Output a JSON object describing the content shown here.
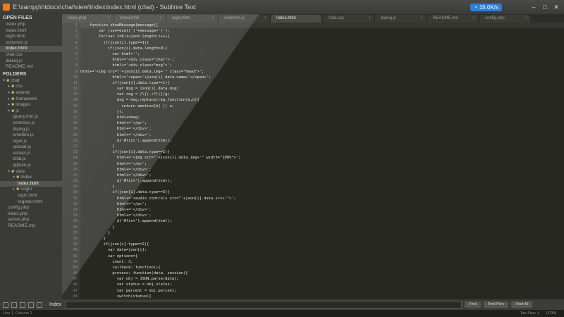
{
  "window": {
    "title": "E:\\xampp\\htdocs\\chat\\view\\Index\\index.html (chat) - Sublime Text",
    "network_badge": "15.0K/s"
  },
  "sidebar": {
    "open_files_label": "OPEN FILES",
    "folders_label": "FOLDERS",
    "open_files": [
      "index.php",
      "index.html",
      "login.html",
      "common.js",
      "Index.html",
      "chat.css",
      "dialog.js",
      "README.md"
    ],
    "open_files_selected": 4,
    "tree": [
      {
        "label": "chat",
        "level": 0,
        "arrow": "▾"
      },
      {
        "label": "css",
        "level": 1,
        "arrow": "▸"
      },
      {
        "label": "extend",
        "level": 1,
        "arrow": "▸"
      },
      {
        "label": "framework",
        "level": 1,
        "arrow": "▸"
      },
      {
        "label": "images",
        "level": 1,
        "arrow": "▸"
      },
      {
        "label": "js",
        "level": 1,
        "arrow": "▾"
      },
      {
        "label": "jquery.min.js",
        "level": 2,
        "arrow": ""
      },
      {
        "label": "common.js",
        "level": 2,
        "arrow": ""
      },
      {
        "label": "dialog.js",
        "level": 2,
        "arrow": ""
      },
      {
        "label": "emotion.js",
        "level": 2,
        "arrow": ""
      },
      {
        "label": "layer.js",
        "level": 2,
        "arrow": ""
      },
      {
        "label": "upload.js",
        "level": 2,
        "arrow": ""
      },
      {
        "label": "socket.js",
        "level": 2,
        "arrow": ""
      },
      {
        "label": "chat.js",
        "level": 2,
        "arrow": ""
      },
      {
        "label": "qqface.js",
        "level": 2,
        "arrow": ""
      },
      {
        "label": "view",
        "level": 1,
        "arrow": "▾"
      },
      {
        "label": "Index",
        "level": 2,
        "arrow": "▾"
      },
      {
        "label": "index.html",
        "level": 3,
        "arrow": ""
      },
      {
        "label": "Login",
        "level": 2,
        "arrow": "▸"
      },
      {
        "label": "login.html",
        "level": 3,
        "arrow": ""
      },
      {
        "label": "register.html",
        "level": 3,
        "arrow": ""
      },
      {
        "label": "config.php",
        "level": 1,
        "arrow": ""
      },
      {
        "label": "index.php",
        "level": 1,
        "arrow": ""
      },
      {
        "label": "server.php",
        "level": 1,
        "arrow": ""
      },
      {
        "label": "README.md",
        "level": 1,
        "arrow": ""
      }
    ],
    "tree_selected": 17
  },
  "tabs": [
    {
      "label": "index.php",
      "active": false
    },
    {
      "label": "index.html",
      "active": false
    },
    {
      "label": "login.html",
      "active": false
    },
    {
      "label": "common.js",
      "active": false
    },
    {
      "label": "Index.html",
      "active": true
    },
    {
      "label": "chat.css",
      "active": false
    },
    {
      "label": "dialog.js",
      "active": false
    },
    {
      "label": "README.md",
      "active": false
    },
    {
      "label": "config.php",
      "active": false
    }
  ],
  "editor": {
    "start_line": 1,
    "highlight_line": 1,
    "lines": [
      "    function showMessage(message){",
      "        var json=eval('('+message+')');",
      "        for(var i=0;i<json.length;i++){",
      "          if(json[i].type==1){",
      "            if(json[i].data.length>0){",
      "              var html='';",
      "              html+='<div class=\"chat\">';",
      "              html+='<div class=\"msg\">';",
      "html+='<img src=\"'+json[i].data.img+'\" class=\"head\">';",
      "              html+='<span>'+json[i].data.name+'</span>';",
      "              if(json[i].data.type==1){",
      "                var msg = json[i].data.msg;",
      "                var reg = /\\[(.+?)\\]/g;",
      "                msg = msg.replace(reg,function(a,b){",
      "                  return emotion[b] || a;",
      "                });",
      "                html+=msg;",
      "                html+='</p>';",
      "                html+='</div>';",
      "                html+='</div>';",
      "                $('#list').append(html);",
      "              }",
      "              if(json[i].data.type==2){",
      "                html+='<img src=\"'+json[i].data.img+'\" width=\"100%\">';",
      "                html+='</p>';",
      "                html+='</div>';",
      "                html+='</div>';",
      "                $('#list').append(html);",
      "              }",
      "              if(json[i].data.type==3){",
      "                html+='<audio controls src=\"'+json[i].data.src+'\">';",
      "                html+='</p>';",
      "                html+='</div>';",
      "                html+='</div>';",
      "                $('#list').append(html);",
      "              }",
      "            }",
      "          }",
      "          if(json[i].type==2){",
      "            var data=json[i];",
      "            var options={",
      "              count: 3,",
      "              callback: function(){",
      "              process: function(data, session){",
      "                var obj = JSON.parse(data);",
      "                var status = obj.status;",
      "                var percent = obj.percent;",
      "                switch(status){",
      "                  case 0:"
    ]
  },
  "statusbar": {
    "find_label": "Index",
    "find_button": "Find",
    "find_prev": "Find Prev",
    "find_all": "Find All"
  },
  "bottombar": {
    "left": "Line 1, Column 1",
    "tab_size": "Tab Size: 4",
    "syntax": "HTML"
  }
}
